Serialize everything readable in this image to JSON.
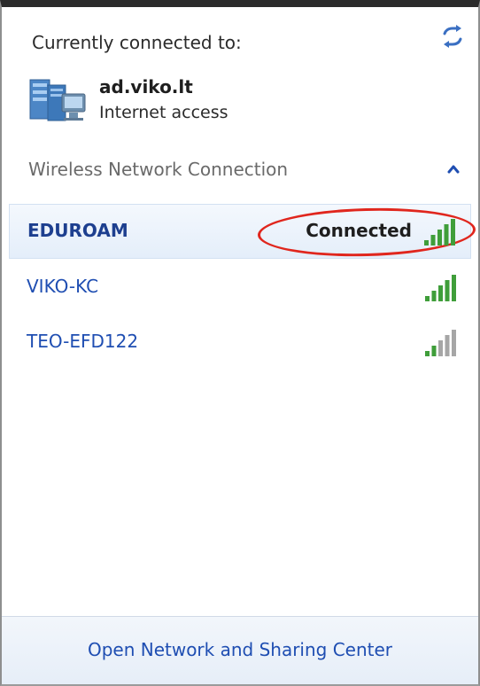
{
  "current": {
    "title": "Currently connected to:",
    "network_name": "ad.viko.lt",
    "access": "Internet access"
  },
  "section": {
    "title": "Wireless Network Connection"
  },
  "networks": [
    {
      "ssid": "EDUROAM",
      "status": "Connected",
      "signal_bars": 5
    },
    {
      "ssid": "VIKO-KC",
      "status": "",
      "signal_bars": 5
    },
    {
      "ssid": "TEO-EFD122",
      "status": "",
      "signal_bars": 2
    }
  ],
  "footer": {
    "link": "Open Network and Sharing Center"
  },
  "colors": {
    "link": "#1f4eb2",
    "signal_on": "#3f9e3a",
    "signal_off": "#a6a6a6",
    "annotation": "#e0261d"
  }
}
